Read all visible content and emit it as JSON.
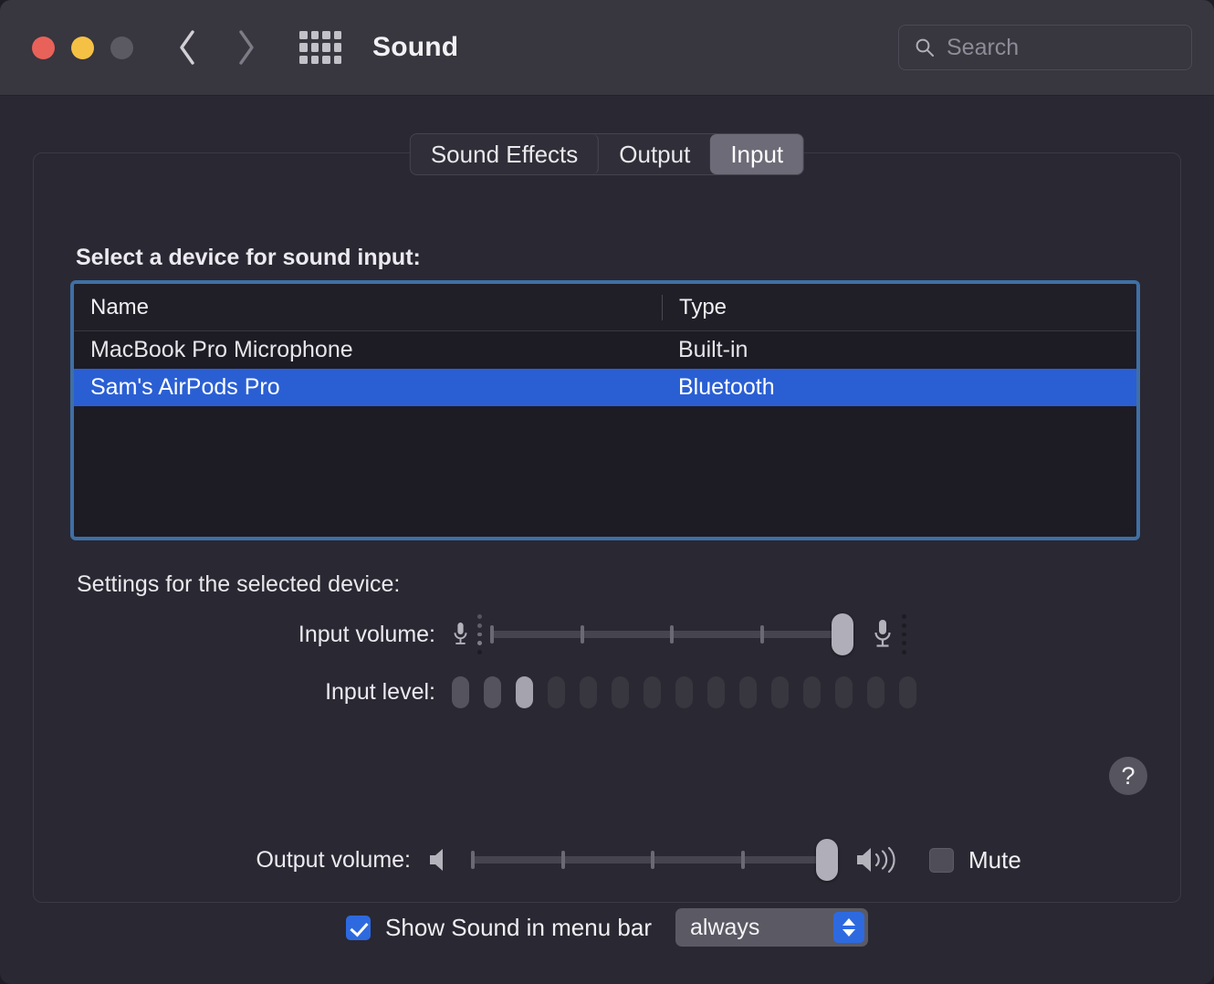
{
  "window": {
    "title": "Sound",
    "traffic_lights": [
      "close",
      "minimize",
      "zoom"
    ]
  },
  "toolbar": {
    "back_icon": "chevron-left-icon",
    "forward_icon": "chevron-right-icon",
    "grid_icon": "show-all-grid-icon",
    "search": {
      "icon": "search-icon",
      "placeholder": "Search",
      "value": ""
    }
  },
  "tabs": [
    {
      "label": "Sound Effects",
      "active": false
    },
    {
      "label": "Output",
      "active": false
    },
    {
      "label": "Input",
      "active": true
    }
  ],
  "main": {
    "device_section_label": "Select a device for sound input:",
    "table": {
      "columns": [
        "Name",
        "Type",
        ""
      ],
      "rows": [
        {
          "name": "MacBook Pro Microphone",
          "type": "Built-in",
          "selected": false
        },
        {
          "name": "Sam's AirPods Pro",
          "type": "Bluetooth",
          "selected": true
        }
      ],
      "focus_ring_color": "#3f6fa5",
      "selection_color": "#2a5fd4"
    },
    "settings_label": "Settings for the selected device:",
    "input_volume": {
      "label": "Input volume:",
      "left_icon": "microphone-small-icon",
      "right_icon": "microphone-large-icon",
      "value_percent": 95,
      "ticks_percent": [
        0,
        25,
        50,
        75
      ]
    },
    "input_level": {
      "label": "Input level:",
      "segments_total": 15,
      "segments_lit": 3,
      "segment_states": [
        "mid",
        "mid",
        "lit",
        "off",
        "off",
        "off",
        "off",
        "off",
        "off",
        "off",
        "off",
        "off",
        "off",
        "off",
        "off"
      ]
    },
    "help_button": {
      "icon": "question-mark-icon",
      "label": "?"
    }
  },
  "footer": {
    "output_volume": {
      "label": "Output volume:",
      "left_icon": "speaker-quiet-icon",
      "right_icon": "speaker-loud-icon",
      "value_percent": 96,
      "ticks_percent": [
        0,
        25,
        50,
        75
      ]
    },
    "mute": {
      "label": "Mute",
      "checked": false
    },
    "show_in_menu_bar": {
      "label": "Show Sound in menu bar",
      "checked": true
    },
    "menu_bar_visibility": {
      "value": "always",
      "stepper_icon": "chevron-up-down-icon",
      "accent_color": "#2d6ae0"
    }
  }
}
